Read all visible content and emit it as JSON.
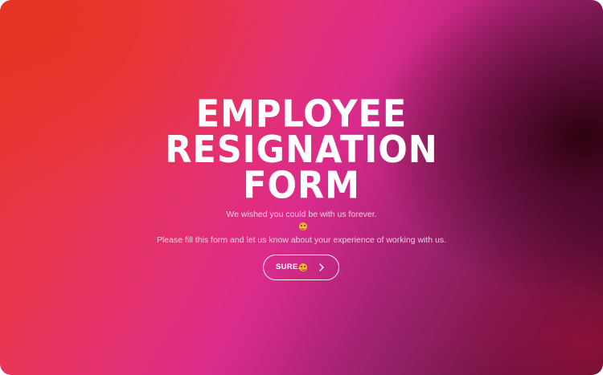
{
  "form": {
    "title_lines": [
      "EMPLOYEE",
      "RESIGNATION",
      "FORM"
    ],
    "subtitle_lines": [
      "We wished you could be with us forever.",
      "Please fill this form and let us know about your experience of working with us."
    ],
    "subtitle_emoji_icon": "grimacing-face-icon",
    "cta": {
      "label": "SURE.",
      "emoji_icon": "grimacing-face-icon",
      "arrow_icon": "chevron-right-icon"
    }
  },
  "colors": {
    "gradient_start": "#e6352e",
    "gradient_mid": "#d92b8c",
    "gradient_end": "#3a0a25",
    "text": "#ffffff"
  }
}
